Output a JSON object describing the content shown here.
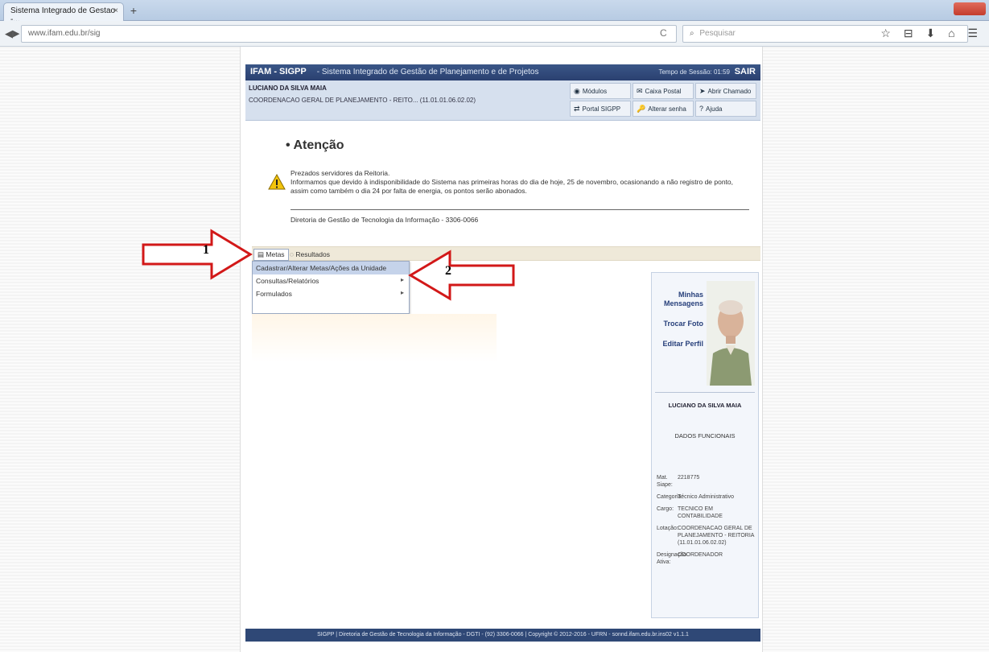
{
  "browser": {
    "tab_title": "Sistema Integrado de Gestao -...",
    "tab_close": "×",
    "new_tab": "+",
    "url": "www.ifam.edu.br/sig",
    "reload": "C",
    "search_placeholder": "Pesquisar",
    "toolbar_icons": "☆ ⊟ ⬇ ⌂ ☰"
  },
  "header": {
    "app_name": "IFAM - SIGPP",
    "app_desc": "- Sistema Integrado de Gestão de Planejamento e de Projetos",
    "timer": "Tempo de Sessão: 01:59",
    "logout": "SAIR"
  },
  "user": {
    "name": "LUCIANO DA SILVA MAIA",
    "unit": "COORDENACAO GERAL DE PLANEJAMENTO - REITO... (11.01.01.06.02.02)"
  },
  "quick_links": [
    {
      "label": "Módulos",
      "icon": "◉"
    },
    {
      "label": "Caixa Postal",
      "icon": "✉"
    },
    {
      "label": "Abrir Chamado",
      "icon": "➤"
    },
    {
      "label": "Portal SIGPP",
      "icon": "⇄"
    },
    {
      "label": "Alterar senha",
      "icon": "🔑"
    },
    {
      "label": "Ajuda",
      "icon": "?"
    }
  ],
  "notice": {
    "title": "Atenção",
    "paragraph1": "Prezados servidores da Reitoria.",
    "paragraph2": "Informamos que devido à indisponibilidade do Sistema nas primeiras horas do dia de hoje, 25 de novembro, ocasionando a não registro de ponto, assim como também o dia 24 por falta de energia, os pontos serão abonados.",
    "signature": "Diretoria de Gestão de Tecnologia da Informação - 3306-0066"
  },
  "menu": {
    "items": [
      "Metas",
      "Resultados"
    ],
    "dropdown": [
      {
        "label": "Cadastrar/Alterar Metas/Ações da Unidade",
        "submenu": false
      },
      {
        "label": "Consultas/Relatórios",
        "submenu": true
      },
      {
        "label": "Formulados",
        "submenu": true
      }
    ],
    "submenu_arrow": "▸"
  },
  "profile": {
    "links": [
      "Minhas Mensagens",
      "Trocar Foto",
      "Editar Perfil"
    ],
    "name": "LUCIANO DA SILVA MAIA",
    "section_title": "DADOS FUNCIONAIS",
    "details": [
      {
        "key": "Mat. Siape:",
        "value": "2218775"
      },
      {
        "key": "Categoria:",
        "value": "Técnico Administrativo"
      },
      {
        "key": "Cargo:",
        "value": "TECNICO EM CONTABILIDADE"
      },
      {
        "key": "Lotação:",
        "value": "COORDENACAO GERAL DE PLANEJAMENTO - REITORIA (11.01.01.06.02.02)"
      },
      {
        "key": "Designação Ativa:",
        "value": "COORDENADOR"
      }
    ]
  },
  "footer": {
    "text": "SIGPP | Diretoria de Gestão de Tecnologia da Informação - DGTI - (92) 3306-0066 | Copyright © 2012-2016 - UFRN - sonnd.ifam.edu.br.ins02 v1.1.1"
  },
  "annotations": {
    "arrow1_label": "1",
    "arrow2_label": "2"
  }
}
